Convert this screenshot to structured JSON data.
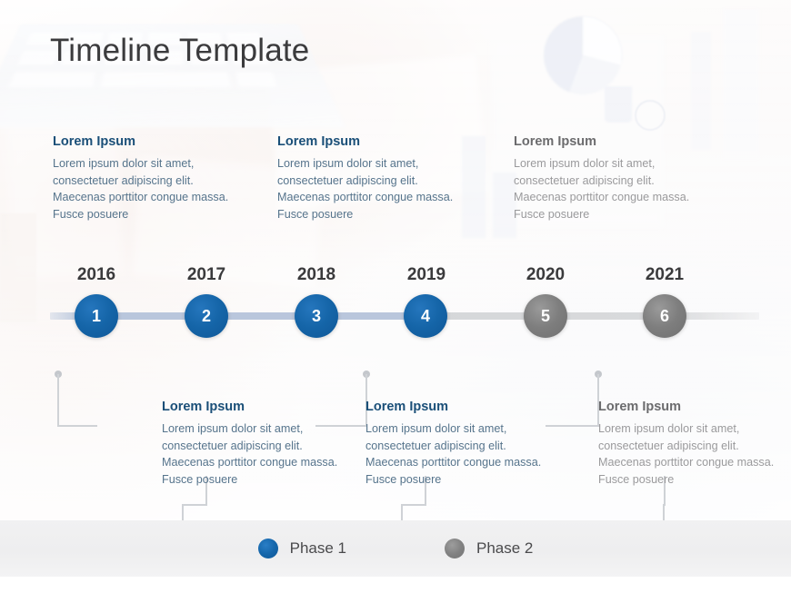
{
  "slide": {
    "title": "Timeline Template",
    "background_tint": "#fdfbfa",
    "accent_blue": "#1565a8",
    "accent_gray": "#7e7e7e",
    "axis_blue": "#b9c6dc",
    "axis_gray": "#d9dadc"
  },
  "milestones": [
    {
      "number": "1",
      "year": "2016",
      "phase": "blue",
      "position": "above",
      "title": "Lorem Ipsum",
      "body": "Lorem ipsum dolor sit amet, consectetuer adipiscing elit. Maecenas porttitor congue massa. Fusce posuere"
    },
    {
      "number": "2",
      "year": "2017",
      "phase": "blue",
      "position": "below",
      "title": "Lorem Ipsum",
      "body": "Lorem ipsum dolor sit amet, consectetuer adipiscing elit. Maecenas porttitor congue massa. Fusce posuere"
    },
    {
      "number": "3",
      "year": "2018",
      "phase": "blue",
      "position": "above",
      "title": "Lorem Ipsum",
      "body": "Lorem ipsum dolor sit amet, consectetuer adipiscing elit. Maecenas porttitor congue massa. Fusce posuere"
    },
    {
      "number": "4",
      "year": "2019",
      "phase": "blue",
      "position": "below",
      "title": "Lorem Ipsum",
      "body": "Lorem ipsum dolor sit amet, consectetuer adipiscing elit. Maecenas porttitor congue massa. Fusce posuere"
    },
    {
      "number": "5",
      "year": "2020",
      "phase": "gray",
      "position": "above",
      "title": "Lorem Ipsum",
      "body": "Lorem ipsum dolor sit amet, consectetuer adipiscing elit. Maecenas porttitor congue massa. Fusce posuere"
    },
    {
      "number": "6",
      "year": "2021",
      "phase": "gray",
      "position": "below",
      "title": "Lorem Ipsum",
      "body": "Lorem ipsum dolor sit amet, consectetuer adipiscing elit. Maecenas porttitor congue massa. Fusce posuere"
    }
  ],
  "legend": {
    "items": [
      {
        "label": "Phase 1",
        "color": "#1565a8"
      },
      {
        "label": "Phase 2",
        "color": "#7e7e7e"
      }
    ]
  }
}
